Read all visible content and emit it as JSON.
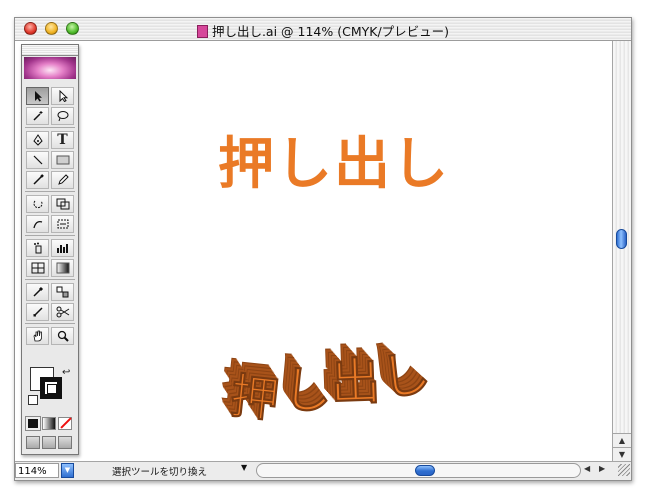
{
  "window": {
    "title": "押し出し.ai @ 114% (CMYK/プレビュー)",
    "doc_icon": "illustrator-doc-icon",
    "traffic_lights": [
      "close",
      "minimize",
      "zoom"
    ]
  },
  "artwork": {
    "flat_text": "押し出し",
    "extruded_chars": [
      "押",
      "し",
      "出",
      "し"
    ],
    "color_face": "#ea7a26",
    "color_side": "#a8531a"
  },
  "toolbox": {
    "tools": [
      "selection-tool",
      "direct-selection-tool",
      "magic-wand-tool",
      "lasso-tool",
      "pen-tool",
      "type-tool",
      "line-segment-tool",
      "rectangle-tool",
      "paintbrush-tool",
      "pencil-tool",
      "rotate-tool",
      "scale-tool",
      "warp-tool",
      "free-transform-tool",
      "symbol-sprayer-tool",
      "column-graph-tool",
      "mesh-tool",
      "gradient-tool",
      "eyedropper-tool",
      "blend-tool",
      "slice-tool",
      "scissors-tool",
      "hand-tool",
      "zoom-tool"
    ],
    "type_glyph": "T"
  },
  "status": {
    "zoom": "114%",
    "text": "選択ツールを切り換え",
    "dropdown_arrow": "▼",
    "left_arrow": "◀",
    "right_arrow": "▶"
  },
  "scrollbar": {
    "up_arrow": "▲",
    "down_arrow": "▼"
  }
}
